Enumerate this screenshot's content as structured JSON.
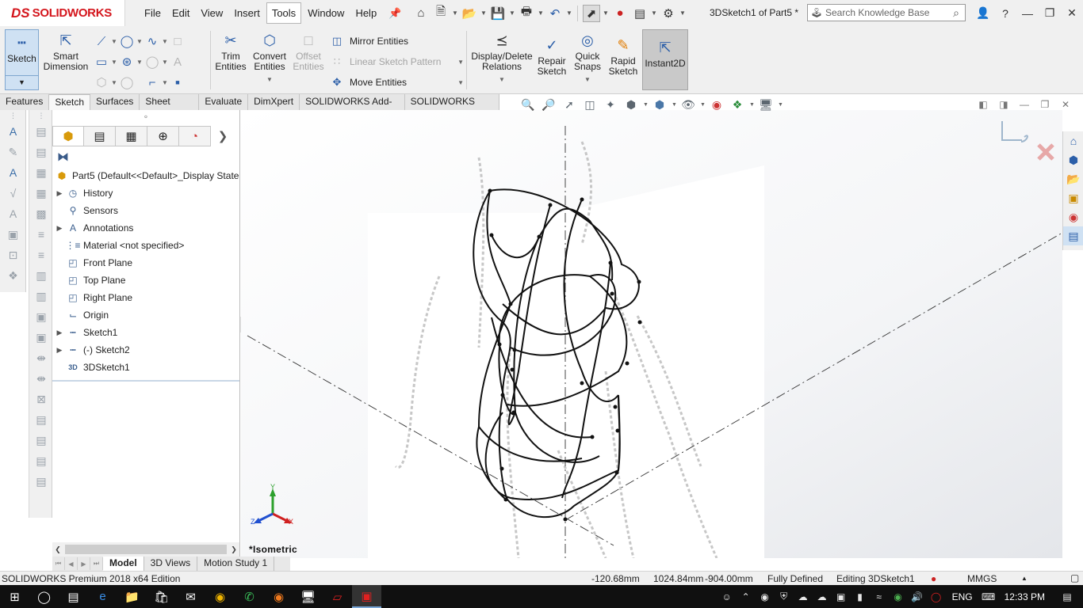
{
  "app": {
    "logo_ds": "DS",
    "logo_name": "SOLIDWORKS",
    "document_title": "3DSketch1 of Part5 *",
    "search_placeholder": "Search Knowledge Base"
  },
  "menu": [
    "File",
    "Edit",
    "View",
    "Insert",
    "Tools",
    "Window",
    "Help"
  ],
  "menu_active": "Tools",
  "command_manager": {
    "sketch": "Sketch",
    "smart_dimension": [
      "Smart",
      "Dimension"
    ],
    "trim_entities": [
      "Trim",
      "Entities"
    ],
    "convert_entities": [
      "Convert",
      "Entities"
    ],
    "offset_entities": [
      "Offset",
      "Entities"
    ],
    "mirror_entities": "Mirror Entities",
    "linear_sketch_pattern": "Linear Sketch Pattern",
    "move_entities": "Move Entities",
    "display_delete_relations": [
      "Display/Delete",
      "Relations"
    ],
    "repair_sketch": [
      "Repair",
      "Sketch"
    ],
    "quick_snaps": [
      "Quick",
      "Snaps"
    ],
    "rapid_sketch": [
      "Rapid",
      "Sketch"
    ],
    "instant2d": "Instant2D"
  },
  "command_tabs": [
    "Features",
    "Sketch",
    "Surfaces",
    "Sheet Metal",
    "Evaluate",
    "DimXpert",
    "SOLIDWORKS Add-Ins",
    "SOLIDWORKS MBD"
  ],
  "command_tab_active": "Sketch",
  "feature_tree": {
    "root": "Part5  (Default<<Default>_Display State",
    "items": [
      {
        "label": "History",
        "expand": true,
        "icon": "history-icon"
      },
      {
        "label": "Sensors",
        "expand": false,
        "icon": "sensors-icon"
      },
      {
        "label": "Annotations",
        "expand": true,
        "icon": "annotations-icon"
      },
      {
        "label": "Material <not specified>",
        "expand": false,
        "icon": "material-icon"
      },
      {
        "label": "Front Plane",
        "expand": false,
        "icon": "plane-icon"
      },
      {
        "label": "Top Plane",
        "expand": false,
        "icon": "plane-icon"
      },
      {
        "label": "Right Plane",
        "expand": false,
        "icon": "plane-icon"
      },
      {
        "label": "Origin",
        "expand": false,
        "icon": "origin-icon"
      },
      {
        "label": "Sketch1",
        "expand": true,
        "icon": "sketch-icon"
      },
      {
        "label": "(-) Sketch2",
        "expand": true,
        "icon": "sketch-icon"
      },
      {
        "label": "3DSketch1",
        "expand": false,
        "icon": "3dsketch-icon"
      }
    ]
  },
  "viewport": {
    "view_name": "*Isometric",
    "triad": {
      "y": "Y",
      "x": "X",
      "z": "Z"
    }
  },
  "bottom_tabs": [
    "Model",
    "3D Views",
    "Motion Study 1"
  ],
  "bottom_tab_active": "Model",
  "status": {
    "edition": "SOLIDWORKS Premium 2018 x64 Edition",
    "x": "-120.68mm",
    "y": "1024.84mm",
    "z": "-904.00mm",
    "state": "Fully Defined",
    "editing": "Editing 3DSketch1",
    "units": "MMGS"
  },
  "taskbar": {
    "lang": "ENG",
    "time": "12:33 PM"
  }
}
